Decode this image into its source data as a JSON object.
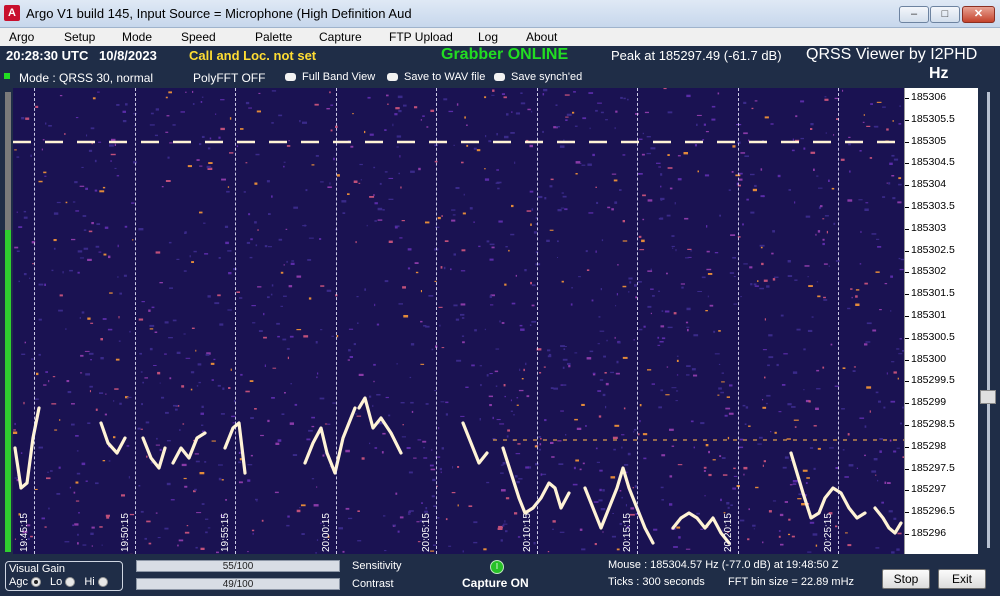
{
  "window": {
    "title": "Argo V1 build 145, Input Source = Microphone (High Definition Aud",
    "icon": "argo-app-icon"
  },
  "menu": [
    "Argo",
    "Setup",
    "Mode",
    "Speed",
    "Palette",
    "Capture",
    "FTP Upload",
    "Log",
    "About"
  ],
  "header": {
    "time": "20:28:30 UTC",
    "date": "10/8/2023",
    "callsign_status": "Call and Loc. not set",
    "grabber_status": "Grabber ONLINE",
    "peak": "Peak at  185297.49 (-61.7 dB)",
    "app_title": "QRSS Viewer by I2PHD",
    "unit": "Hz",
    "mode": "Mode : QRSS 30, normal",
    "polyfft": "PolyFFT OFF",
    "full_band_view": "Full Band View",
    "save_wav": "Save to WAV file",
    "save_synched": "Save synch'ed"
  },
  "spectrogram": {
    "time_labels": [
      "19:45:15",
      "19:50:15",
      "19:55:15",
      "20:00:15",
      "20:05:15",
      "20:10:15",
      "20:15:15",
      "20:20:15",
      "20:25:15"
    ],
    "freq_labels": [
      "185306",
      "185305.5",
      "185305",
      "185304.5",
      "185304",
      "185303.5",
      "185303",
      "185302.5",
      "185302",
      "185301.5",
      "185301",
      "185300.5",
      "185300",
      "185299.5",
      "185299",
      "185298.5",
      "185298",
      "185297.5",
      "185297",
      "185296.5",
      "185296"
    ],
    "colors": {
      "background": "#1a1252",
      "signal": "#fff3d6",
      "grid": "#eaeaff"
    }
  },
  "bottom": {
    "visual_gain": "Visual Gain",
    "agc": "Agc",
    "lo": "Lo",
    "hi": "Hi",
    "sensitivity_value": "55/100",
    "sensitivity_label": "Sensitivity",
    "contrast_value": "49/100",
    "contrast_label": "Contrast",
    "capture_status": "Capture ON",
    "mouse": "Mouse :   185304.57 Hz  (-77.0 dB) at 19:48:50 Z",
    "ticks": "Ticks  : 300 seconds",
    "fft_bin": "FFT bin size = 22.89 mHz",
    "stop_label": "Stop",
    "exit_label": "Exit"
  }
}
